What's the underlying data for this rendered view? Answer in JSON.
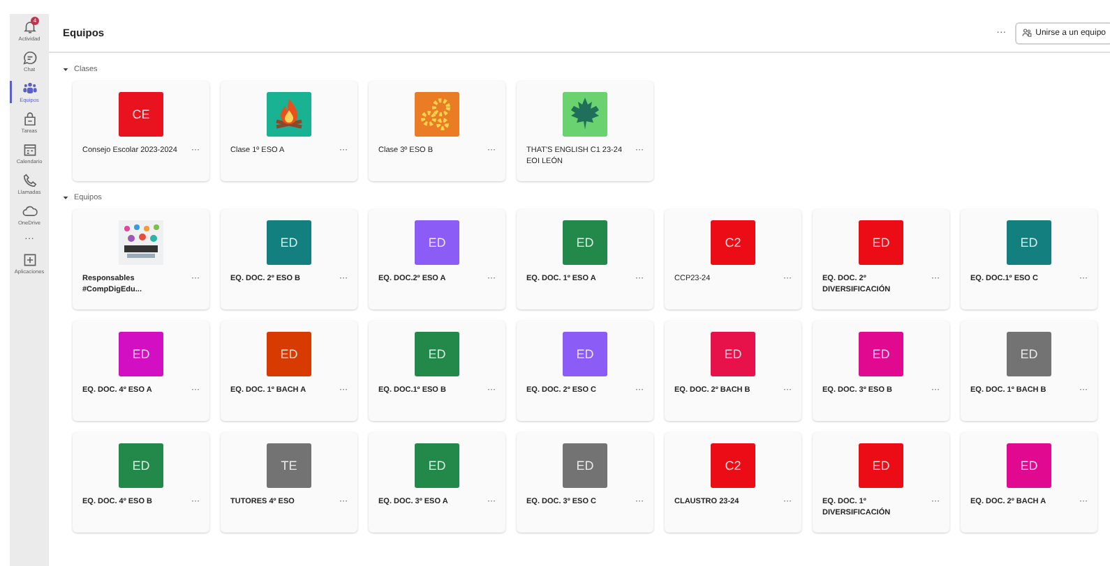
{
  "rail": {
    "items": [
      {
        "kind": "bell",
        "label": "Actividad",
        "selected": false,
        "badge": "4"
      },
      {
        "kind": "chat",
        "label": "Chat",
        "selected": false
      },
      {
        "kind": "teams",
        "label": "Equipos",
        "selected": true
      },
      {
        "kind": "bag",
        "label": "Tareas",
        "selected": false
      },
      {
        "kind": "calendar",
        "label": "Calendario",
        "selected": false
      },
      {
        "kind": "phone",
        "label": "Llamadas",
        "selected": false
      },
      {
        "kind": "cloud",
        "label": "OneDrive",
        "selected": false
      },
      {
        "kind": "more",
        "label": "···",
        "selected": false
      },
      {
        "kind": "apps",
        "label": "Aplicaciones",
        "selected": false
      }
    ]
  },
  "header": {
    "title": "Equipos",
    "more": "···",
    "join_button": "Unirse a un equipo"
  },
  "sections": [
    {
      "title": "Clases",
      "expanded": true,
      "cards": [
        {
          "kind": "initials",
          "initials": "CE",
          "color": "#e8131f",
          "name": "Consejo Escolar 2023-2024",
          "bold": false,
          "more": "···"
        },
        {
          "kind": "fire",
          "name": "Clase 1º ESO A",
          "bold": false,
          "more": "···"
        },
        {
          "kind": "gears",
          "name": "Clase 3º ESO B",
          "bold": false,
          "more": "···"
        },
        {
          "kind": "leaf",
          "name": "THAT'S ENGLISH C1 23-24 EOI LEÓN",
          "bold": false,
          "more": "···"
        }
      ]
    },
    {
      "title": "Equipos",
      "expanded": true,
      "cards": [
        {
          "kind": "picture",
          "name": "Responsables #CompDigEdu...",
          "bold": true,
          "more": "···"
        },
        {
          "kind": "initials",
          "initials": "ED",
          "color": "#13807f",
          "name": "EQ. DOC. 2º ESO B",
          "bold": true,
          "more": "···"
        },
        {
          "kind": "initials",
          "initials": "ED",
          "color": "#8b5cf6",
          "name": "EQ. DOC.2º ESO A",
          "bold": true,
          "more": "···"
        },
        {
          "kind": "initials",
          "initials": "ED",
          "color": "#23894b",
          "name": "EQ. DOC. 1º ESO A",
          "bold": true,
          "more": "···"
        },
        {
          "kind": "initials",
          "initials": "C2",
          "color": "#ec0c15",
          "name": "CCP23-24",
          "bold": false,
          "more": "···"
        },
        {
          "kind": "initials",
          "initials": "ED",
          "color": "#ec0c15",
          "name": "EQ. DOC. 2º DIVERSIFICACIÓN",
          "bold": true,
          "more": "···"
        },
        {
          "kind": "initials",
          "initials": "ED",
          "color": "#13807f",
          "name": "EQ. DOC.1º ESO C",
          "bold": true,
          "more": "···"
        },
        {
          "kind": "initials",
          "initials": "ED",
          "color": "#d30fc4",
          "name": "EQ. DOC. 4º ESO A",
          "bold": true,
          "more": "···"
        },
        {
          "kind": "initials",
          "initials": "ED",
          "color": "#d83b01",
          "name": "EQ. DOC. 1º BACH A",
          "bold": true,
          "more": "···"
        },
        {
          "kind": "initials",
          "initials": "ED",
          "color": "#23894b",
          "name": "EQ. DOC.1º ESO B",
          "bold": true,
          "more": "···"
        },
        {
          "kind": "initials",
          "initials": "ED",
          "color": "#8b5cf6",
          "name": "EQ. DOC. 2º ESO C",
          "bold": true,
          "more": "···"
        },
        {
          "kind": "initials",
          "initials": "ED",
          "color": "#e8124a",
          "name": "EQ. DOC. 2º BACH B",
          "bold": true,
          "more": "···"
        },
        {
          "kind": "initials",
          "initials": "ED",
          "color": "#e0098f",
          "name": "EQ. DOC. 3º ESO B",
          "bold": true,
          "more": "···"
        },
        {
          "kind": "initials",
          "initials": "ED",
          "color": "#737373",
          "name": "EQ. DOC. 1º BACH B",
          "bold": true,
          "more": "···"
        },
        {
          "kind": "initials",
          "initials": "ED",
          "color": "#23894b",
          "name": "EQ. DOC. 4º ESO B",
          "bold": true,
          "more": "···"
        },
        {
          "kind": "initials",
          "initials": "TE",
          "color": "#737373",
          "name": "TUTORES 4º ESO",
          "bold": true,
          "more": "···"
        },
        {
          "kind": "initials",
          "initials": "ED",
          "color": "#23894b",
          "name": "EQ. DOC. 3º ESO A",
          "bold": true,
          "more": "···"
        },
        {
          "kind": "initials",
          "initials": "ED",
          "color": "#737373",
          "name": "EQ. DOC. 3º ESO C",
          "bold": true,
          "more": "···"
        },
        {
          "kind": "initials",
          "initials": "C2",
          "color": "#ec0c15",
          "name": "CLAUSTRO 23-24",
          "bold": true,
          "more": "···"
        },
        {
          "kind": "initials",
          "initials": "ED",
          "color": "#ec0c15",
          "name": "EQ. DOC. 1º DIVERSIFICACIÓN",
          "bold": true,
          "more": "···"
        },
        {
          "kind": "initials",
          "initials": "ED",
          "color": "#e0098f",
          "name": "EQ. DOC. 2º BACH A",
          "bold": true,
          "more": "···"
        }
      ]
    }
  ]
}
